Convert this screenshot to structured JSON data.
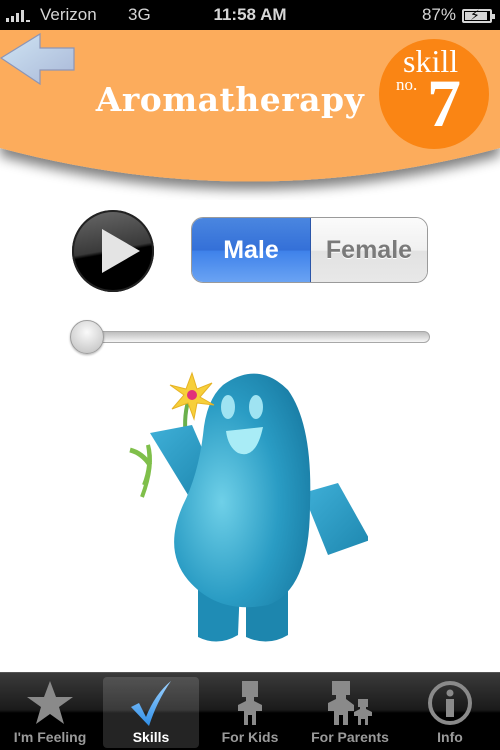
{
  "status_bar": {
    "carrier": "Verizon",
    "network": "3G",
    "time": "11:58 AM",
    "battery_percent": "87%"
  },
  "header": {
    "back_icon": "left-arrow-icon",
    "title": "Aromatherapy",
    "badge": {
      "skill_word": "skill",
      "no_word": "no.",
      "number": "7"
    },
    "colors": {
      "banner": "#fcac5c",
      "badge": "#fa8514"
    }
  },
  "controls": {
    "play_icon": "play-icon",
    "voice_options": [
      "Male",
      "Female"
    ],
    "selected_voice": "Male",
    "audio_progress": 0,
    "accent": "#3f82ea"
  },
  "illustration": {
    "description": "Blue smiling mascot holding a yellow flower"
  },
  "tab_bar": {
    "tabs": [
      {
        "label": "I'm Feeling",
        "icon": "star-icon",
        "active": false
      },
      {
        "label": "Skills",
        "icon": "checkmark-icon",
        "active": true
      },
      {
        "label": "For Kids",
        "icon": "kid-icon",
        "active": false
      },
      {
        "label": "For Parents",
        "icon": "parent-child-icon",
        "active": false
      },
      {
        "label": "Info",
        "icon": "info-icon",
        "active": false
      }
    ]
  }
}
